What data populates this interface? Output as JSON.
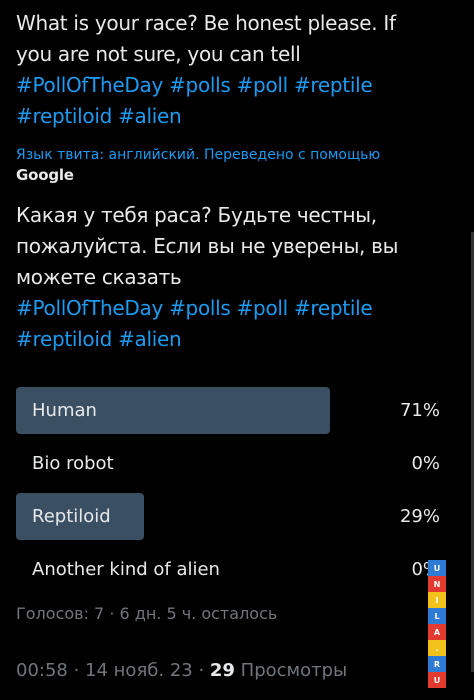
{
  "tweet": {
    "original_lines": [
      "What is your race? Be honest please. If",
      "you are not sure, you can tell"
    ],
    "hashtags": [
      "#PollOfTheDay",
      "#polls",
      "#poll",
      "#reptile",
      "#reptiloid",
      "#alien"
    ]
  },
  "translation": {
    "note": "Язык твита: английский. Переведено с помощью",
    "provider": "Google",
    "lines": [
      "Какая у тебя раса? Будьте честны,",
      "пожалуйста. Если вы не уверены, вы",
      "можете сказать"
    ]
  },
  "poll": {
    "options": [
      {
        "label": "Human",
        "percent": "71%",
        "share": 0.71
      },
      {
        "label": "Bio robot",
        "percent": "0%",
        "share": 0.0
      },
      {
        "label": "Reptiloid",
        "percent": "29%",
        "share": 0.29
      },
      {
        "label": "Another kind of alien",
        "percent": "0%",
        "share": 0.0
      }
    ],
    "meta": "Голосов: 7 · 6 дн. 5 ч. осталось"
  },
  "footer": {
    "time": "00:58 · 14 нояб. 23 · ",
    "views_count": "29",
    "views_label": " Просмотры"
  },
  "watermark": {
    "letters": [
      "U",
      "N",
      "I",
      "L",
      "A",
      ".",
      "R",
      "U"
    ],
    "colors": [
      "#2e7bd6",
      "#e23a2f",
      "#f2c21a",
      "#2e7bd6",
      "#e23a2f",
      "#f2c21a",
      "#2e7bd6",
      "#e23a2f"
    ]
  },
  "colors": {
    "hashtag": "#1d9bf0",
    "poll_bar": "#3b4f63",
    "muted": "#71767b"
  }
}
